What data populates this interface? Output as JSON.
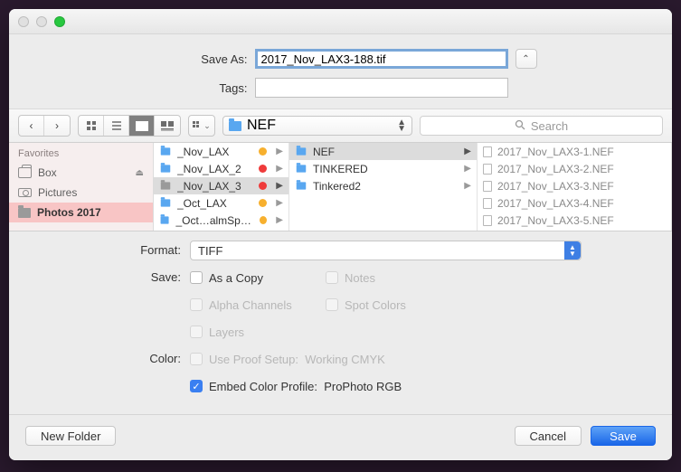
{
  "traffic_lights": {
    "close": "#e0e0e0",
    "min": "#e0e0e0",
    "zoom": "#28c840"
  },
  "labels": {
    "save_as": "Save As:",
    "tags": "Tags:",
    "format": "Format:",
    "save_group": "Save:",
    "color_group": "Color:"
  },
  "fields": {
    "save_as_value": "2017_Nov_LAX3-188.tif",
    "tags_value": ""
  },
  "toolbar": {
    "path_label": "NEF",
    "search_placeholder": "Search"
  },
  "sidebar": {
    "header": "Favorites",
    "items": [
      {
        "label": "Box",
        "icon": "box",
        "eject": true
      },
      {
        "label": "Pictures",
        "icon": "camera"
      },
      {
        "label": "Photos 2017",
        "icon": "folder",
        "selected": true
      }
    ]
  },
  "columns": {
    "c1": [
      {
        "label": "_Nov_LAX",
        "tag": "#f7b02e"
      },
      {
        "label": "_Nov_LAX_2",
        "tag": "#ef3b3b"
      },
      {
        "label": "_Nov_LAX_3",
        "tag": "#ef3b3b",
        "selected": true
      },
      {
        "label": "_Oct_LAX",
        "tag": "#f7b02e"
      },
      {
        "label": "_Oct…almSprings",
        "tag": "#f7b02e"
      }
    ],
    "c2": [
      {
        "label": "NEF",
        "selected": true
      },
      {
        "label": "TINKERED"
      },
      {
        "label": "Tinkered2"
      }
    ],
    "c3": [
      {
        "label": "2017_Nov_LAX3-1.NEF"
      },
      {
        "label": "2017_Nov_LAX3-2.NEF"
      },
      {
        "label": "2017_Nov_LAX3-3.NEF"
      },
      {
        "label": "2017_Nov_LAX3-4.NEF"
      },
      {
        "label": "2017_Nov_LAX3-5.NEF"
      }
    ]
  },
  "format_select": {
    "value": "TIFF"
  },
  "save_opts": {
    "as_copy": "As a Copy",
    "alpha": "Alpha Channels",
    "layers": "Layers",
    "notes": "Notes",
    "spot": "Spot Colors"
  },
  "color_opts": {
    "proof_label": "Use Proof Setup:",
    "proof_value": "Working CMYK",
    "embed_label": "Embed Color Profile:",
    "embed_value": "ProPhoto RGB"
  },
  "footer": {
    "new_folder": "New Folder",
    "cancel": "Cancel",
    "save": "Save"
  }
}
